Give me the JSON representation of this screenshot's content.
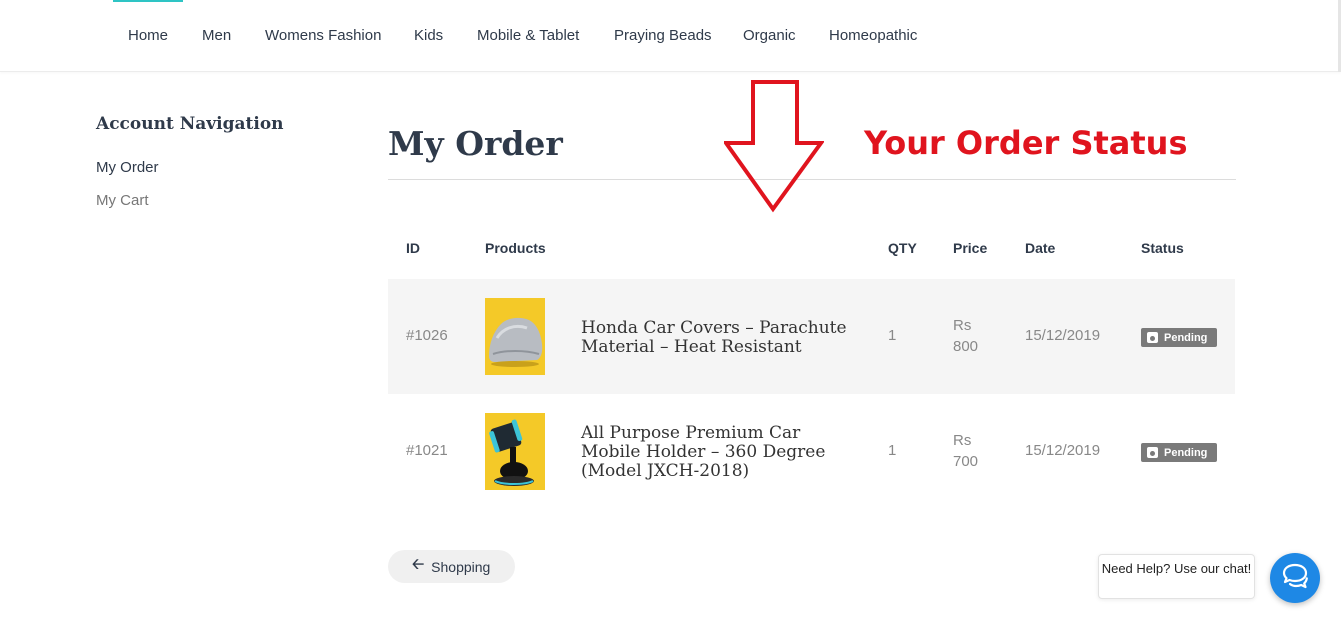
{
  "nav": {
    "items": [
      {
        "label": "Home"
      },
      {
        "label": "Men"
      },
      {
        "label": "Womens Fashion"
      },
      {
        "label": "Kids"
      },
      {
        "label": "Mobile & Tablet"
      },
      {
        "label": "Praying Beads"
      },
      {
        "label": "Organic"
      },
      {
        "label": "Homeopathic"
      }
    ]
  },
  "sidebar": {
    "title": "Account Navigation",
    "items": [
      {
        "label": "My Order"
      },
      {
        "label": "My Cart"
      }
    ]
  },
  "main": {
    "title": "My Order",
    "annotation": "Your Order Status",
    "annotation_color": "#e0141e",
    "table": {
      "headers": {
        "id": "ID",
        "products": "Products",
        "qty": "QTY",
        "price": "Price",
        "date": "Date",
        "status": "Status"
      },
      "rows": [
        {
          "id": "#1026",
          "product_image": "car-cover-image",
          "product": "Honda Car Covers – Parachute Material – Heat Resistant",
          "qty": "1",
          "price_currency": "Rs",
          "price_amount": "800",
          "date": "15/12/2019",
          "status": "Pending"
        },
        {
          "id": "#1021",
          "product_image": "car-mobile-holder-image",
          "product": "All Purpose Premium Car Mobile Holder – 360 Degree (Model JXCH-2018)",
          "qty": "1",
          "price_currency": "Rs",
          "price_amount": "700",
          "date": "15/12/2019",
          "status": "Pending"
        }
      ]
    }
  },
  "shopping_button": {
    "label": "Shopping",
    "icon": "arrow-left-icon"
  },
  "chat": {
    "bubble_text": "Need Help? Use our chat!",
    "icon": "chat-icon",
    "color": "#1e88e5"
  },
  "accent_color": "#2ec4c4"
}
